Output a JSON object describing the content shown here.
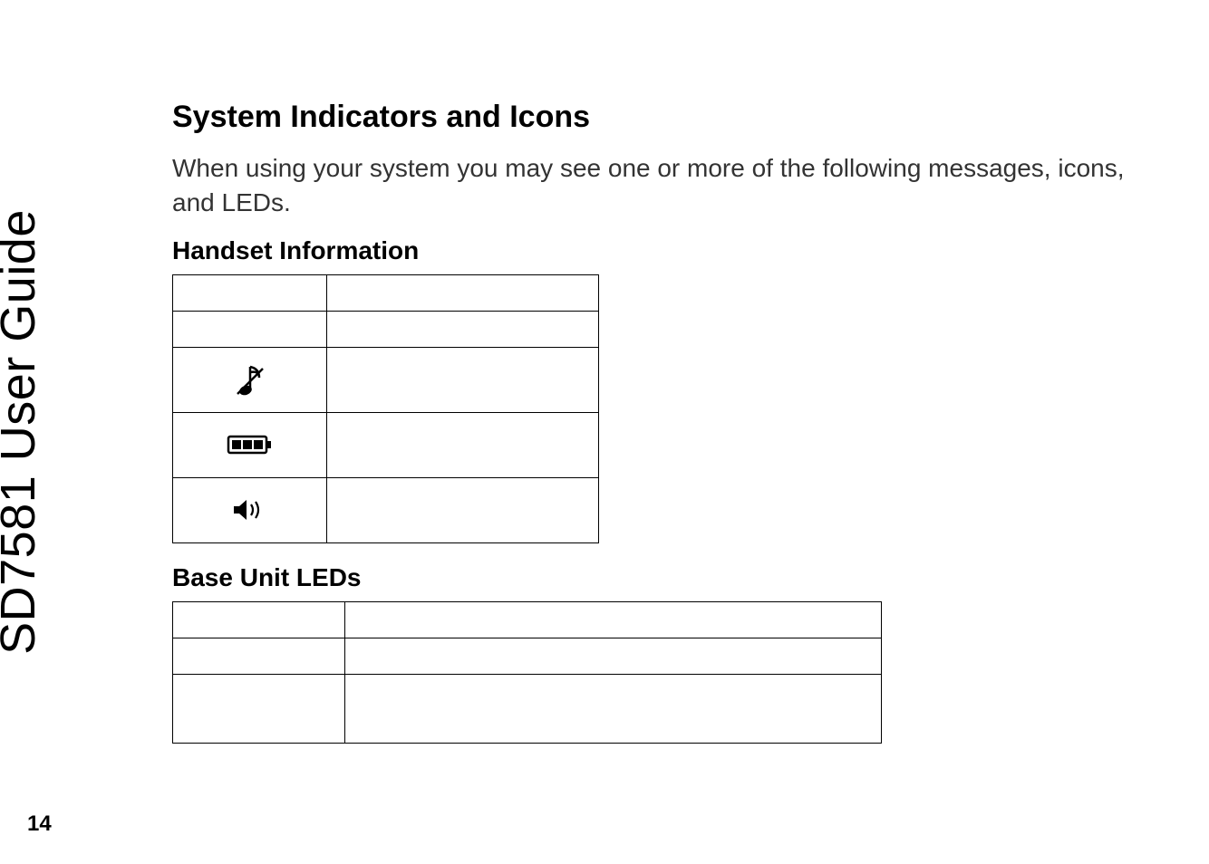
{
  "spine_title": "SD7581 User Guide",
  "section_heading": "System Indicators and Icons",
  "intro_text": "When using your system you may see one or more of the following messages, icons, and LEDs.",
  "handset_heading": "Handset Information",
  "base_heading": "Base Unit LEDs",
  "page_number": "14",
  "icons": {
    "music": "music-note-icon",
    "battery": "battery-icon",
    "speaker": "speaker-icon"
  }
}
